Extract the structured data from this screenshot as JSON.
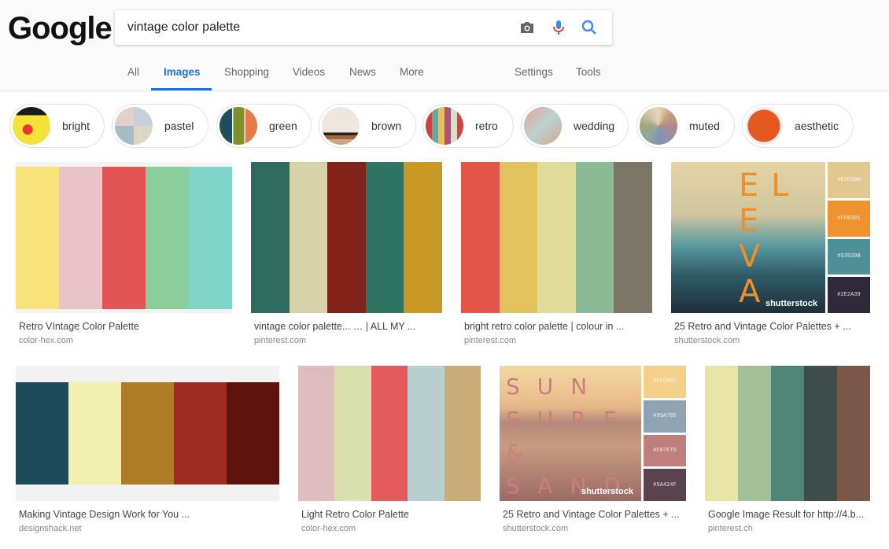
{
  "header": {
    "logo": "Google",
    "query": "vintage color palette"
  },
  "tabs": [
    {
      "label": "All"
    },
    {
      "label": "Images",
      "active": true
    },
    {
      "label": "Shopping"
    },
    {
      "label": "Videos"
    },
    {
      "label": "News"
    },
    {
      "label": "More"
    },
    {
      "label": "Settings"
    },
    {
      "label": "Tools"
    }
  ],
  "chips": [
    {
      "label": "bright"
    },
    {
      "label": "pastel"
    },
    {
      "label": "green"
    },
    {
      "label": "brown"
    },
    {
      "label": "retro"
    },
    {
      "label": "wedding"
    },
    {
      "label": "muted"
    },
    {
      "label": "aesthetic"
    }
  ],
  "results": [
    {
      "title": "Retro VIntage Color Palette",
      "source": "color-hex.com",
      "colors": [
        "#f7e37a",
        "#e8c3c8",
        "#e45455",
        "#8ccd9e",
        "#7fd6c8"
      ]
    },
    {
      "title": "vintage color palette... … | ALL MY ...",
      "source": "pinterest.com",
      "colors": [
        "#2e6a5e",
        "#d6d3a8",
        "#81231a",
        "#2f7462",
        "#c89a24"
      ]
    },
    {
      "title": "bright retro color palette | colour in ...",
      "source": "pinterest.com",
      "colors": [
        "#e35549",
        "#e3c15c",
        "#e0da9b",
        "#8cba95",
        "#7a7565"
      ]
    },
    {
      "title": "25 Retro and Vintage Color Palettes + ...",
      "source": "shutterstock.com",
      "image_text": "ELEVATE",
      "watermark": "shutterstock",
      "swatches": [
        {
          "hex": "#E3C09A",
          "color": "#e0c890"
        },
        {
          "hex": "#FD9301",
          "color": "#ef9230"
        },
        {
          "hex": "#53929B",
          "color": "#4f8f97"
        },
        {
          "hex": "#2E2A39",
          "color": "#2e2a39"
        }
      ]
    },
    {
      "title": "Making Vintage Design Work for You ...",
      "source": "designshack.net",
      "colors": [
        "#1d4b5a",
        "#f2f0b0",
        "#ae7b28",
        "#a02b22",
        "#5d120d"
      ]
    },
    {
      "title": "Light Retro Color Palette",
      "source": "color-hex.com",
      "colors": [
        "#dfbcc0",
        "#d8e0ad",
        "#e45a5c",
        "#b8cfcd",
        "#c9ad78"
      ]
    },
    {
      "title": "25 Retro and Vintage Color Palettes + ...",
      "source": "shutterstock.com",
      "image_text": "SUN SURF & SAND",
      "watermark": "shutterstock",
      "swatches": [
        {
          "hex": "#FCD997",
          "color": "#f4d08a"
        },
        {
          "hex": "#95A7B5",
          "color": "#8fa3b2"
        },
        {
          "hex": "#C07F7D",
          "color": "#c07f7d"
        },
        {
          "hex": "#5A424F",
          "color": "#5a424f"
        }
      ]
    },
    {
      "title": "Google Image Result for http://4.b...",
      "source": "pinterest.ch",
      "colors": [
        "#e8e4a6",
        "#a3bf97",
        "#4f8574",
        "#3e4d4b",
        "#7a564b"
      ]
    }
  ]
}
